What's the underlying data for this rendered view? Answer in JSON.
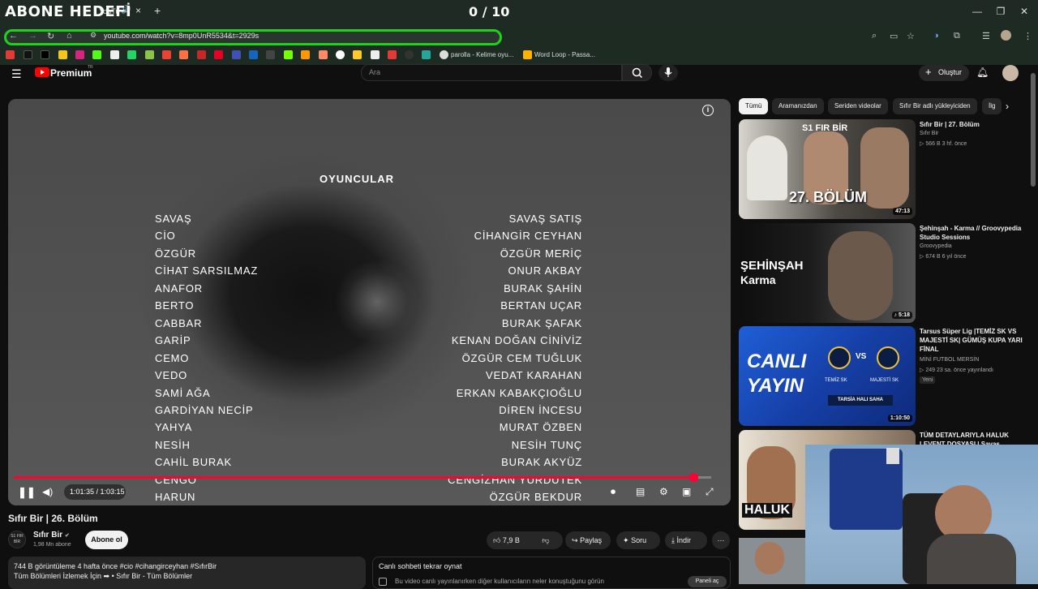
{
  "overlay": {
    "title": "ABONE HEDEFİ",
    "counter": "0 / 10"
  },
  "browser": {
    "tab_label": "YouTu",
    "url": "youtube.com/watch?v=8mp0UnR5534&t=2929s",
    "bookmarks": [
      {
        "label": "parolla - Kelime oyu..."
      },
      {
        "label": "Word Loop - Passa..."
      }
    ]
  },
  "youtube": {
    "logo_text": "Premium",
    "logo_sup": "TR",
    "search_placeholder": "Ara",
    "create_label": "Oluştur"
  },
  "player": {
    "credits_title": "OYUNCULAR",
    "credits": [
      {
        "role": "SAVAŞ",
        "actor": "SAVAŞ SATIŞ"
      },
      {
        "role": "CİO",
        "actor": "CİHANGİR CEYHAN"
      },
      {
        "role": "ÖZGÜR",
        "actor": "ÖZGÜR MERİÇ"
      },
      {
        "role": "CİHAT SARSILMAZ",
        "actor": "ONUR AKBAY"
      },
      {
        "role": "ANAFOR",
        "actor": "BURAK ŞAHİN"
      },
      {
        "role": "BERTO",
        "actor": "BERTAN UÇAR"
      },
      {
        "role": "CABBAR",
        "actor": "BURAK ŞAFAK"
      },
      {
        "role": "GARİP",
        "actor": "KENAN DOĞAN CİNİVİZ"
      },
      {
        "role": "CEMO",
        "actor": "ÖZGÜR CEM TUĞLUK"
      },
      {
        "role": "VEDO",
        "actor": "VEDAT KARAHAN"
      },
      {
        "role": "SAMİ AĞA",
        "actor": "ERKAN KABAKÇIOĞLU"
      },
      {
        "role": "GARDİYAN NECİP",
        "actor": "DİREN İNCESU"
      },
      {
        "role": "YAHYA",
        "actor": "MURAT ÖZBEN"
      },
      {
        "role": "NESİH",
        "actor": "NESİH TUNÇ"
      },
      {
        "role": "CAHİL BURAK",
        "actor": "BURAK AKYÜZ"
      },
      {
        "role": "CENGO",
        "actor": "CENGİZHAN YURDUTEK"
      },
      {
        "role": "HARUN",
        "actor": "ÖZGÜR BEKDUR"
      }
    ],
    "time": "1:01:35 / 1:03:15",
    "progress": 0.974,
    "watermark": "S1 FIR BİR"
  },
  "video": {
    "title": "Sıfır Bir | 26. Bölüm",
    "channel": "Sıfır Bir",
    "subscribers": "1,98 Mn abone",
    "subscribe_label": "Abone ol",
    "likes": "7,9 B",
    "share_label": "Paylaş",
    "ask_label": "Soru",
    "download_label": "İndir",
    "desc_line1": "744 B görüntüleme  4 hafta önce  #cio #cihangirceyhan #SıfırBir",
    "desc_line2": "Tüm Bölümleri İzlemek İçin ➡  • Sıfır Bir - Tüm Bölümler",
    "chat_title": "Canlı sohbeti tekrar oynat",
    "chat_sub": "Bu video canlı yayınlanırken diğer kullanıcıların neler konuştuğunu görün",
    "chat_button": "Paneli aç"
  },
  "sidebar": {
    "chips": [
      "Tümü",
      "Aramanızdan",
      "Seriden videolar",
      "Sıfır Bir adlı yükleyiciden",
      "İlg"
    ],
    "videos": [
      {
        "title": "Sıfır Bir | 27. Bölüm",
        "channel": "Sıfır Bir",
        "meta": "▷ 566 B  3 hf. önce",
        "duration": "47:13",
        "thumb_text": "27. BÖLÜM",
        "thumb_brand": "S1 FIR BİR"
      },
      {
        "title": "Şehinşah - Karma // Groovypedia Studio Sessions",
        "channel": "Groovypedia",
        "meta": "▷ 674 B  6 yıl önce",
        "duration": "♪ 5:18",
        "thumb_text": "ŞEHİNŞAH",
        "thumb_sub": "Karma"
      },
      {
        "title": "Tarsus Süper Lig |TEMİZ SK VS MAJESTİ SK| GÜMÜŞ KUPA YARI FİNAL",
        "channel": "MİNİ FUTBOL MERSİN",
        "meta": "▷ 249  23 sa. önce yayınlandı",
        "badge": "Yeni",
        "duration": "1:10:50",
        "thumb_text": "CANLI",
        "thumb_sub": "YAYIN",
        "thumb_teams": [
          "TEMİZ SK",
          "MAJESTİ SK"
        ],
        "thumb_venue": "TARSİA HALI SAHA"
      },
      {
        "title": "TÜM DETAYLARIYLA HALUK LEVENT DOSYASI | Savaş",
        "thumb_text": "HALUK"
      }
    ]
  },
  "colors": {
    "accent_red": "#ff0033",
    "omnibox_border": "#21d11e",
    "yt_red": "#ff0000"
  }
}
